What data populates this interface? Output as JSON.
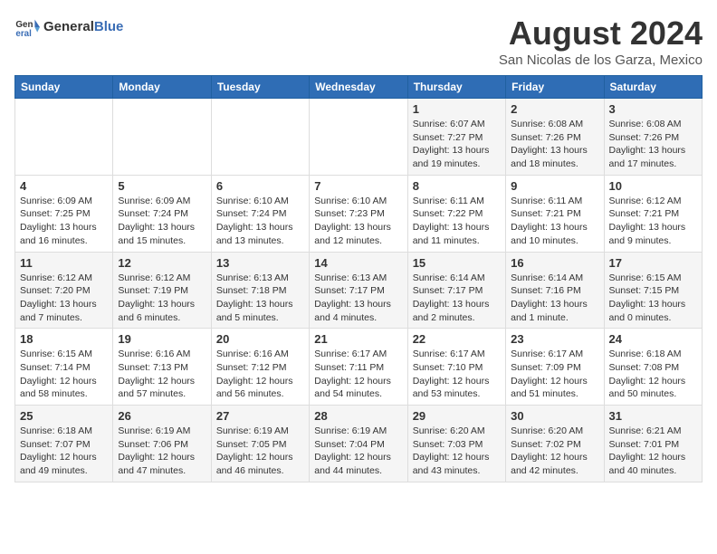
{
  "logo": {
    "general": "General",
    "blue": "Blue"
  },
  "title": "August 2024",
  "subtitle": "San Nicolas de los Garza, Mexico",
  "headers": [
    "Sunday",
    "Monday",
    "Tuesday",
    "Wednesday",
    "Thursday",
    "Friday",
    "Saturday"
  ],
  "weeks": [
    [
      {
        "day": "",
        "info": ""
      },
      {
        "day": "",
        "info": ""
      },
      {
        "day": "",
        "info": ""
      },
      {
        "day": "",
        "info": ""
      },
      {
        "day": "1",
        "info": "Sunrise: 6:07 AM\nSunset: 7:27 PM\nDaylight: 13 hours\nand 19 minutes."
      },
      {
        "day": "2",
        "info": "Sunrise: 6:08 AM\nSunset: 7:26 PM\nDaylight: 13 hours\nand 18 minutes."
      },
      {
        "day": "3",
        "info": "Sunrise: 6:08 AM\nSunset: 7:26 PM\nDaylight: 13 hours\nand 17 minutes."
      }
    ],
    [
      {
        "day": "4",
        "info": "Sunrise: 6:09 AM\nSunset: 7:25 PM\nDaylight: 13 hours\nand 16 minutes."
      },
      {
        "day": "5",
        "info": "Sunrise: 6:09 AM\nSunset: 7:24 PM\nDaylight: 13 hours\nand 15 minutes."
      },
      {
        "day": "6",
        "info": "Sunrise: 6:10 AM\nSunset: 7:24 PM\nDaylight: 13 hours\nand 13 minutes."
      },
      {
        "day": "7",
        "info": "Sunrise: 6:10 AM\nSunset: 7:23 PM\nDaylight: 13 hours\nand 12 minutes."
      },
      {
        "day": "8",
        "info": "Sunrise: 6:11 AM\nSunset: 7:22 PM\nDaylight: 13 hours\nand 11 minutes."
      },
      {
        "day": "9",
        "info": "Sunrise: 6:11 AM\nSunset: 7:21 PM\nDaylight: 13 hours\nand 10 minutes."
      },
      {
        "day": "10",
        "info": "Sunrise: 6:12 AM\nSunset: 7:21 PM\nDaylight: 13 hours\nand 9 minutes."
      }
    ],
    [
      {
        "day": "11",
        "info": "Sunrise: 6:12 AM\nSunset: 7:20 PM\nDaylight: 13 hours\nand 7 minutes."
      },
      {
        "day": "12",
        "info": "Sunrise: 6:12 AM\nSunset: 7:19 PM\nDaylight: 13 hours\nand 6 minutes."
      },
      {
        "day": "13",
        "info": "Sunrise: 6:13 AM\nSunset: 7:18 PM\nDaylight: 13 hours\nand 5 minutes."
      },
      {
        "day": "14",
        "info": "Sunrise: 6:13 AM\nSunset: 7:17 PM\nDaylight: 13 hours\nand 4 minutes."
      },
      {
        "day": "15",
        "info": "Sunrise: 6:14 AM\nSunset: 7:17 PM\nDaylight: 13 hours\nand 2 minutes."
      },
      {
        "day": "16",
        "info": "Sunrise: 6:14 AM\nSunset: 7:16 PM\nDaylight: 13 hours\nand 1 minute."
      },
      {
        "day": "17",
        "info": "Sunrise: 6:15 AM\nSunset: 7:15 PM\nDaylight: 13 hours\nand 0 minutes."
      }
    ],
    [
      {
        "day": "18",
        "info": "Sunrise: 6:15 AM\nSunset: 7:14 PM\nDaylight: 12 hours\nand 58 minutes."
      },
      {
        "day": "19",
        "info": "Sunrise: 6:16 AM\nSunset: 7:13 PM\nDaylight: 12 hours\nand 57 minutes."
      },
      {
        "day": "20",
        "info": "Sunrise: 6:16 AM\nSunset: 7:12 PM\nDaylight: 12 hours\nand 56 minutes."
      },
      {
        "day": "21",
        "info": "Sunrise: 6:17 AM\nSunset: 7:11 PM\nDaylight: 12 hours\nand 54 minutes."
      },
      {
        "day": "22",
        "info": "Sunrise: 6:17 AM\nSunset: 7:10 PM\nDaylight: 12 hours\nand 53 minutes."
      },
      {
        "day": "23",
        "info": "Sunrise: 6:17 AM\nSunset: 7:09 PM\nDaylight: 12 hours\nand 51 minutes."
      },
      {
        "day": "24",
        "info": "Sunrise: 6:18 AM\nSunset: 7:08 PM\nDaylight: 12 hours\nand 50 minutes."
      }
    ],
    [
      {
        "day": "25",
        "info": "Sunrise: 6:18 AM\nSunset: 7:07 PM\nDaylight: 12 hours\nand 49 minutes."
      },
      {
        "day": "26",
        "info": "Sunrise: 6:19 AM\nSunset: 7:06 PM\nDaylight: 12 hours\nand 47 minutes."
      },
      {
        "day": "27",
        "info": "Sunrise: 6:19 AM\nSunset: 7:05 PM\nDaylight: 12 hours\nand 46 minutes."
      },
      {
        "day": "28",
        "info": "Sunrise: 6:19 AM\nSunset: 7:04 PM\nDaylight: 12 hours\nand 44 minutes."
      },
      {
        "day": "29",
        "info": "Sunrise: 6:20 AM\nSunset: 7:03 PM\nDaylight: 12 hours\nand 43 minutes."
      },
      {
        "day": "30",
        "info": "Sunrise: 6:20 AM\nSunset: 7:02 PM\nDaylight: 12 hours\nand 42 minutes."
      },
      {
        "day": "31",
        "info": "Sunrise: 6:21 AM\nSunset: 7:01 PM\nDaylight: 12 hours\nand 40 minutes."
      }
    ]
  ]
}
